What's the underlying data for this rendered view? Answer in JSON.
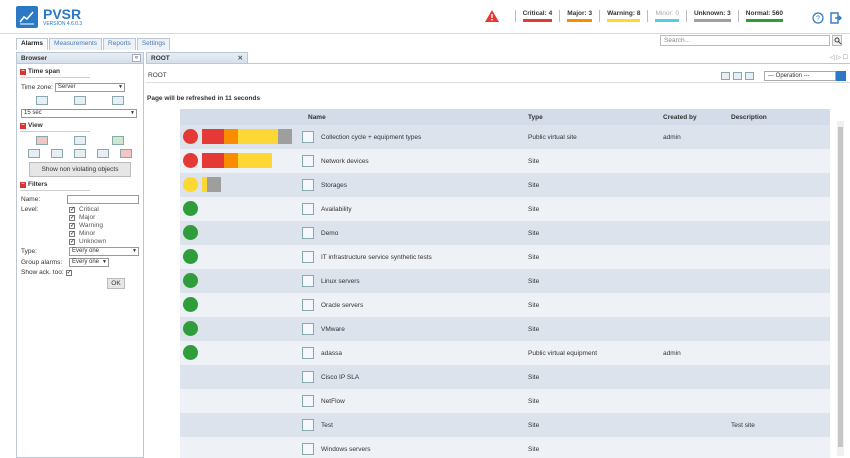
{
  "app": {
    "title": "PVSR",
    "version": "VERSION 4.6.0.3"
  },
  "status": [
    {
      "label": "Critical: 4",
      "color": "#e53935",
      "muted": false
    },
    {
      "label": "Major: 3",
      "color": "#fb8c00",
      "muted": false
    },
    {
      "label": "Warning: 8",
      "color": "#fdd835",
      "muted": false
    },
    {
      "label": "Minor: 0",
      "color": "#4dd0e1",
      "muted": true
    },
    {
      "label": "Unknown: 3",
      "color": "#9e9e9e",
      "muted": false
    },
    {
      "label": "Normal: 560",
      "color": "#2e9d3a",
      "muted": false
    }
  ],
  "tabs": [
    "Alarms",
    "Measurements",
    "Reports",
    "Settings"
  ],
  "search": {
    "placeholder": "Search..."
  },
  "browser": {
    "title": "Browser",
    "timespan": {
      "title": "Time span",
      "timezone_label": "Time zone:",
      "timezone_value": "Server",
      "interval_value": "15 sec"
    },
    "view": {
      "title": "View",
      "button": "Show non violating objects"
    },
    "filters": {
      "title": "Filters",
      "name_label": "Name:",
      "level_label": "Level:",
      "levels": [
        "Critical",
        "Major",
        "Warning",
        "Minor",
        "Unknown"
      ],
      "type_label": "Type:",
      "type_value": "Every one",
      "group_label": "Group alarms:",
      "group_value": "Every one",
      "showack_label": "Show ack. too:",
      "ok": "OK"
    }
  },
  "main": {
    "tab": "ROOT",
    "breadcrumb": "ROOT",
    "operation": "--- Operation ---",
    "refresh": "Page will be refreshed in 11 seconds",
    "columns": [
      "Name",
      "Type",
      "Created by",
      "Description"
    ],
    "rows": [
      {
        "name": "Collection cycle + equipment types",
        "type": "Public virtual site",
        "created": "admin",
        "desc": "",
        "dot": "#e53935",
        "bars": [
          [
            "#e53935",
            22
          ],
          [
            "#fb8c00",
            14
          ],
          [
            "#fdd835",
            40
          ],
          [
            "#9e9e9e",
            14
          ]
        ]
      },
      {
        "name": "Network devices",
        "type": "Site",
        "created": "",
        "desc": "",
        "dot": "#e53935",
        "bars": [
          [
            "#e53935",
            22
          ],
          [
            "#fb8c00",
            14
          ],
          [
            "#fdd835",
            34
          ]
        ]
      },
      {
        "name": "Storages",
        "type": "Site",
        "created": "",
        "desc": "",
        "dot": "#fdd835",
        "bars": [
          [
            "#fdd835",
            5
          ],
          [
            "#9e9e9e",
            14
          ]
        ]
      },
      {
        "name": "Availability",
        "type": "Site",
        "created": "",
        "desc": "",
        "dot": "#2e9d3a",
        "bars": []
      },
      {
        "name": "Demo",
        "type": "Site",
        "created": "",
        "desc": "",
        "dot": "#2e9d3a",
        "bars": []
      },
      {
        "name": "IT infrastructure service synthetic tests",
        "type": "Site",
        "created": "",
        "desc": "",
        "dot": "#2e9d3a",
        "bars": []
      },
      {
        "name": "Linux servers",
        "type": "Site",
        "created": "",
        "desc": "",
        "dot": "#2e9d3a",
        "bars": []
      },
      {
        "name": "Oracle servers",
        "type": "Site",
        "created": "",
        "desc": "",
        "dot": "#2e9d3a",
        "bars": []
      },
      {
        "name": "VMware",
        "type": "Site",
        "created": "",
        "desc": "",
        "dot": "#2e9d3a",
        "bars": []
      },
      {
        "name": "adassa",
        "type": "Public virtual equipment",
        "created": "admin",
        "desc": "",
        "dot": "#2e9d3a",
        "bars": []
      },
      {
        "name": "Cisco IP SLA",
        "type": "Site",
        "created": "",
        "desc": "",
        "dot": "",
        "bars": []
      },
      {
        "name": "NetFlow",
        "type": "Site",
        "created": "",
        "desc": "",
        "dot": "",
        "bars": []
      },
      {
        "name": "Test",
        "type": "Site",
        "created": "",
        "desc": "Test site",
        "dot": "",
        "bars": []
      },
      {
        "name": "Windows servers",
        "type": "Site",
        "created": "",
        "desc": "",
        "dot": "",
        "bars": []
      }
    ]
  }
}
